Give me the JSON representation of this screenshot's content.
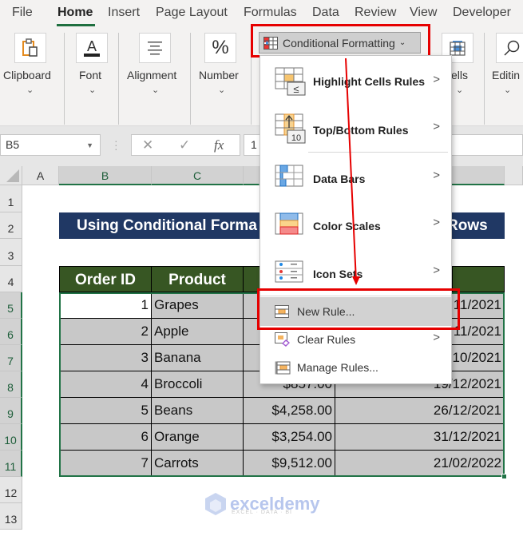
{
  "ribbon_tabs": [
    "File",
    "Home",
    "Insert",
    "Page Layout",
    "Formulas",
    "Data",
    "Review",
    "View",
    "Developer"
  ],
  "active_tab": "Home",
  "ribbon_groups": {
    "clipboard": "Clipboard",
    "font": "Font",
    "alignment": "Alignment",
    "number": "Number",
    "cells": "ells",
    "editing": "Editin"
  },
  "conditional_formatting_label": "Conditional Formatting",
  "formula_bar": {
    "name_box": "B5",
    "cancel_glyph": "✕",
    "enter_glyph": "✓",
    "fx_label": "fx",
    "value": "1"
  },
  "columns": [
    "A",
    "B",
    "C"
  ],
  "rows": [
    "1",
    "2",
    "3",
    "4",
    "5",
    "6",
    "7",
    "8",
    "9",
    "10",
    "11",
    "12",
    "13"
  ],
  "sheet_title_left": "Using Conditional Forma",
  "sheet_title_right": "Rows",
  "table": {
    "headers": [
      "Order ID",
      "Product"
    ],
    "rows": [
      {
        "id": "1",
        "product": "Grapes",
        "amount": "",
        "date": "11/2021"
      },
      {
        "id": "2",
        "product": "Apple",
        "amount": "",
        "date": "11/2021"
      },
      {
        "id": "3",
        "product": "Banana",
        "amount": "",
        "date": "10/2021"
      },
      {
        "id": "4",
        "product": "Broccoli",
        "amount": "$857.00",
        "date": "19/12/2021"
      },
      {
        "id": "5",
        "product": "Beans",
        "amount": "$4,258.00",
        "date": "26/12/2021"
      },
      {
        "id": "6",
        "product": "Orange",
        "amount": "$3,254.00",
        "date": "31/12/2021"
      },
      {
        "id": "7",
        "product": "Carrots",
        "amount": "$9,512.00",
        "date": "21/02/2022"
      }
    ]
  },
  "menu": {
    "items": [
      {
        "label": "Highlight Cells Rules",
        "submenu": true
      },
      {
        "label": "Top/Bottom Rules",
        "submenu": true
      },
      {
        "label": "Data Bars",
        "submenu": true
      },
      {
        "label": "Color Scales",
        "submenu": true
      },
      {
        "label": "Icon Sets",
        "submenu": true
      },
      {
        "label": "New Rule...",
        "submenu": false
      },
      {
        "label": "Clear Rules",
        "submenu": true
      },
      {
        "label": "Manage Rules...",
        "submenu": false
      }
    ],
    "submenu_glyph": ">"
  },
  "watermark": {
    "brand": "exceldemy",
    "tagline": "EXCEL · DATA · BI"
  },
  "colors": {
    "accent_green": "#217346",
    "title_bg": "#203864",
    "header_bg": "#375623",
    "highlight_red": "#e60000"
  }
}
